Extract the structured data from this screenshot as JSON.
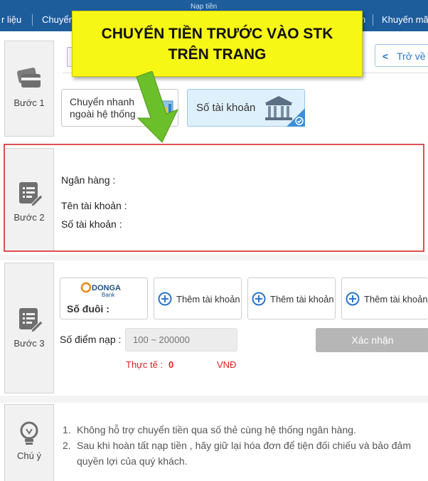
{
  "topnav": {
    "items": [
      "r liệu",
      "Chuyển",
      "n",
      "Khuyến mã"
    ],
    "top_small": "Nạp tiền"
  },
  "banner": {
    "line1": "CHUYỂN TIỀN TRƯỚC VÀO STK",
    "line2": "TRÊN TRANG"
  },
  "back_button": "Trở về",
  "step1": {
    "label": "Bước 1",
    "method_fast": {
      "line1": "Chuyển nhanh",
      "line2": "ngoài hệ thống"
    },
    "method_account": "Số tài khoản"
  },
  "step2": {
    "label": "Bước 2",
    "bank_label": "Ngân hàng :",
    "account_name_label": "Tên tài khoản :",
    "account_number_label": "Số tài khoản :"
  },
  "step3": {
    "label": "Bước 3",
    "bank_logo": {
      "name": "DONGA",
      "sub": "Bank"
    },
    "suffix_label": "Số đuôi :",
    "add_account_label": "Thêm tài khoản",
    "points_label": "Số điểm nạp :",
    "amount_placeholder": "100 ~ 200000",
    "confirm_label": "Xác nhận",
    "actual_label": "Thực tế :",
    "actual_value": "0",
    "currency": "VNĐ"
  },
  "note": {
    "label": "Chú ý",
    "items": [
      {
        "num": "1.",
        "text": "Không hỗ trợ chuyển tiền qua số thẻ cùng hệ thống ngân hàng."
      },
      {
        "num": "2.",
        "text": "Sau khi hoàn tất nạp tiền , hãy giữ lại hóa đơn để tiện đối chiếu và bảo đảm quyền lợi của quý khách."
      }
    ]
  },
  "colors": {
    "nav_bg": "#1e5d9c",
    "banner_bg": "#f7f715",
    "highlight_border": "#e05050",
    "arrow": "#6bbf2a",
    "accent_blue": "#2a76c6"
  }
}
